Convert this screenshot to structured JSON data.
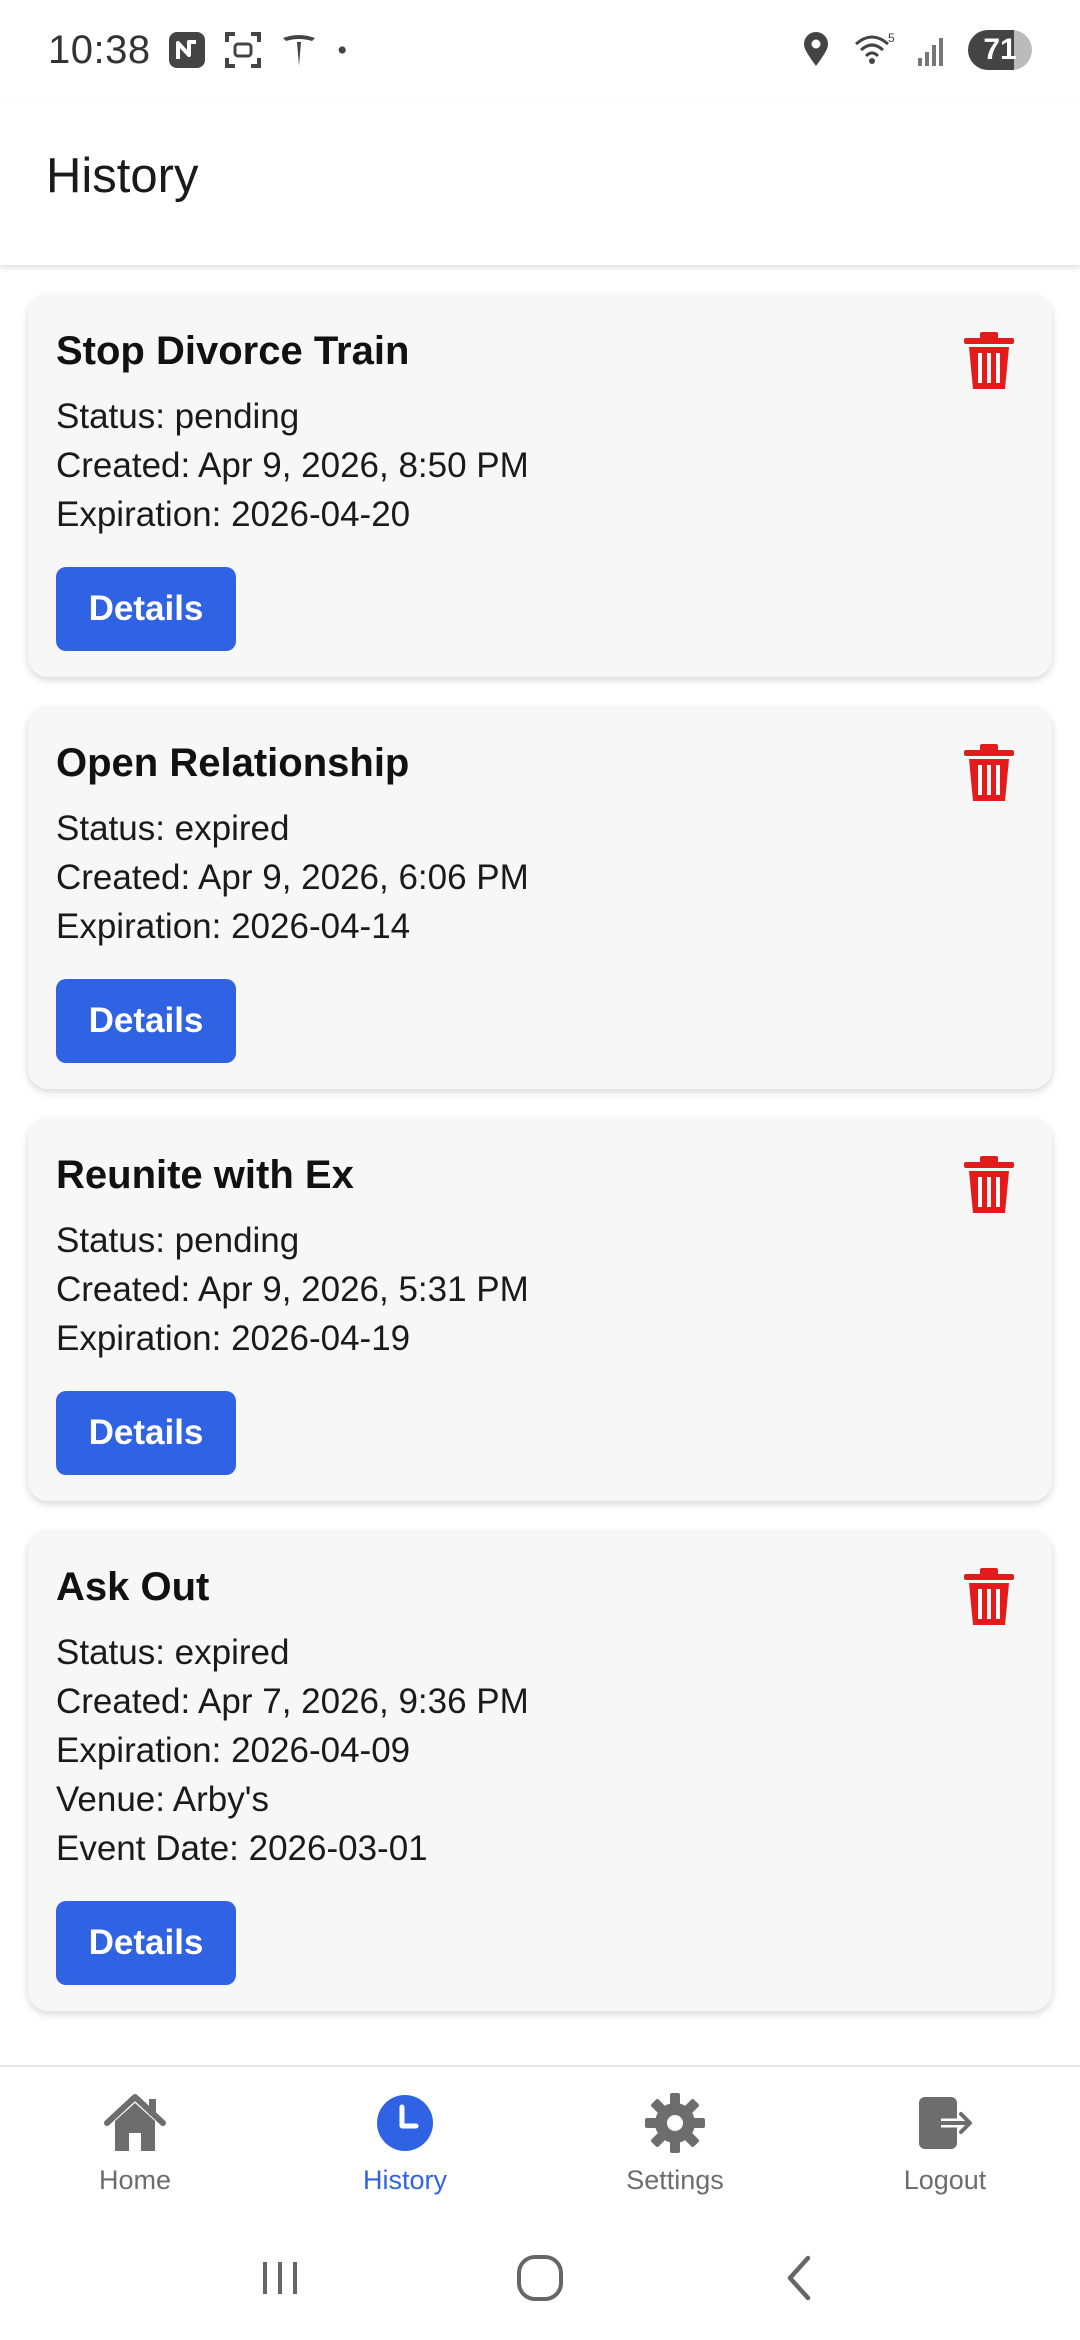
{
  "status_bar": {
    "time": "10:38",
    "battery": "71",
    "icons": [
      "n-app-icon",
      "screenshot-icon",
      "tesla-icon",
      "notification-dot-icon",
      "location-icon",
      "wifi-icon",
      "signal-icon",
      "battery-icon"
    ]
  },
  "header": {
    "title": "History"
  },
  "cards": [
    {
      "title": "Stop Divorce Train",
      "lines": [
        "Status: pending",
        "Created: Apr 9, 2026, 8:50 PM",
        "Expiration: 2026-04-20"
      ],
      "button": "Details"
    },
    {
      "title": "Open Relationship",
      "lines": [
        "Status: expired",
        "Created: Apr 9, 2026, 6:06 PM",
        "Expiration: 2026-04-14"
      ],
      "button": "Details"
    },
    {
      "title": "Reunite with Ex",
      "lines": [
        "Status: pending",
        "Created: Apr 9, 2026, 5:31 PM",
        "Expiration: 2026-04-19"
      ],
      "button": "Details"
    },
    {
      "title": "Ask Out",
      "lines": [
        "Status: expired",
        "Created: Apr 7, 2026, 9:36 PM",
        "Expiration: 2026-04-09",
        "Venue: Arby's",
        "Event Date: 2026-03-01"
      ],
      "button": "Details"
    }
  ],
  "bottom_nav": {
    "items": [
      {
        "label": "Home",
        "icon": "home-icon"
      },
      {
        "label": "History",
        "icon": "clock-icon",
        "active": true
      },
      {
        "label": "Settings",
        "icon": "gear-icon"
      },
      {
        "label": "Logout",
        "icon": "logout-icon"
      }
    ]
  },
  "colors": {
    "accent": "#2f63e4",
    "delete": "#e31b1b",
    "card_bg": "#f7f7f7",
    "nav_inactive": "#6d6d6d"
  }
}
